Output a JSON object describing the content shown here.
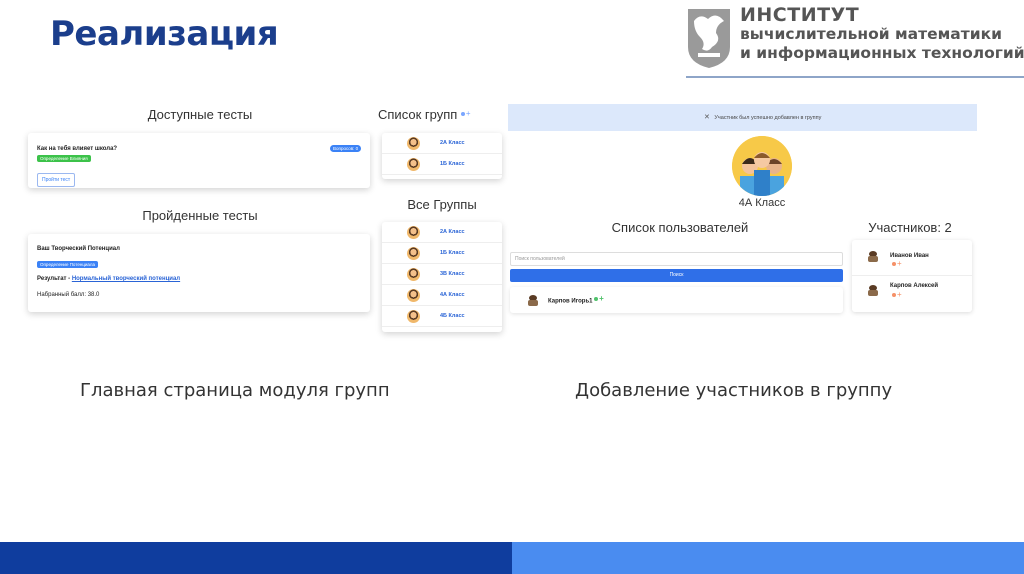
{
  "slide": {
    "title": "Реализация",
    "caption_left": "Главная страница модуля групп",
    "caption_right": "Добавление участников в группу"
  },
  "logo": {
    "line1": "ИНСТИТУТ",
    "line2": "вычислительной математики",
    "line3": "и информационных технологий"
  },
  "left_shot": {
    "available_title": "Доступные тесты",
    "available_test": {
      "name": "Как на тебя влияет школа?",
      "badge": "Определение Влияния",
      "questions_badge": "Вопросов: 0",
      "take_button": "Пройти тест"
    },
    "passed_title": "Пройденные тесты",
    "passed_test": {
      "name": "Ваш Творческий Потенциал",
      "badge": "Определение Потенциала",
      "result_label": "Результат -",
      "result_value": "Нормальный творческий потенциал",
      "score": "Набранный балл: 38.0"
    },
    "my_groups_title": "Список групп",
    "my_groups": [
      "2А Класс",
      "1Б Класс"
    ],
    "all_groups_title": "Все Группы",
    "all_groups": [
      "2А Класс",
      "1Б Класс",
      "3В Класс",
      "4А Класс",
      "4Б Класс"
    ]
  },
  "right_shot": {
    "alert": "Участник был успешно добавлен в группу",
    "group_name": "4А Класс",
    "users_title": "Список пользователей",
    "search_placeholder": "Поиск пользователей",
    "search_button": "Поиск",
    "found_user": "Карпов Игорь1",
    "members_title": "Участников: 2",
    "members": [
      "Иванов Иван",
      "Карпов Алексей"
    ]
  },
  "colors": {
    "title": "#1b3e8c",
    "footer_left": "#0f3d9e",
    "footer_right": "#4a8cf0",
    "link": "#2a64d6"
  }
}
